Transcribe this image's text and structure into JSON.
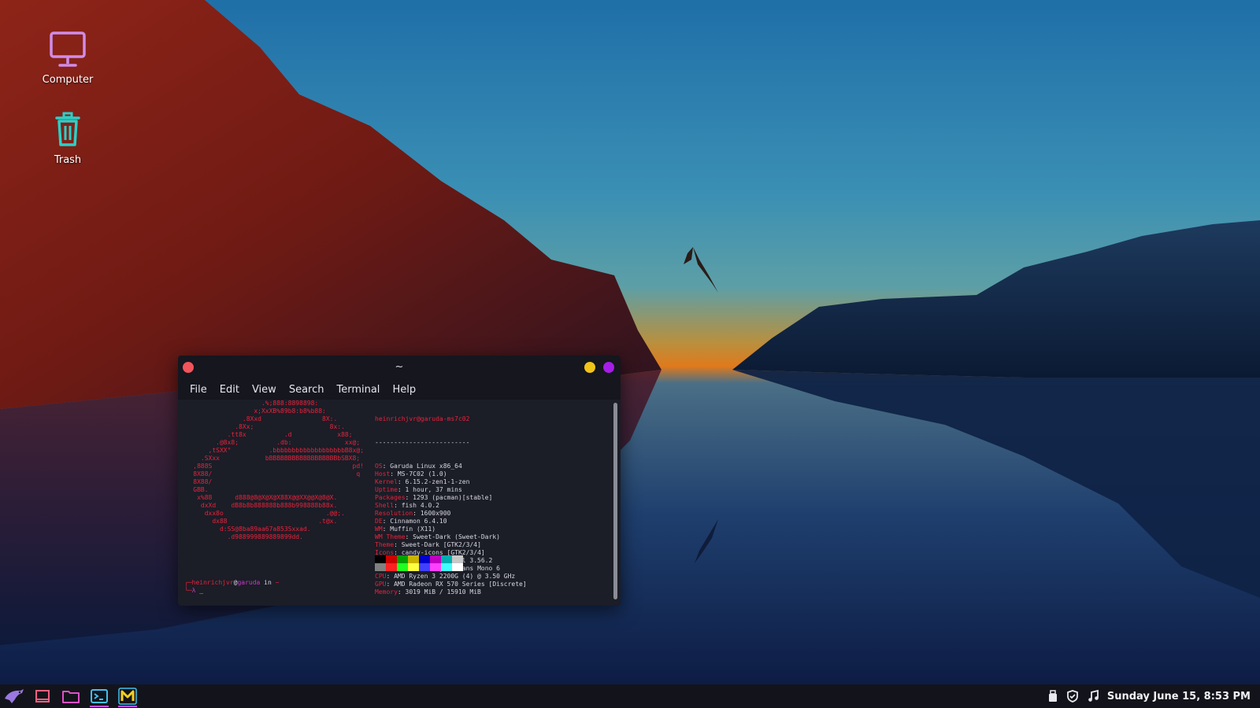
{
  "desktop": {
    "icons": [
      {
        "label": "Computer",
        "icon": "monitor-icon"
      },
      {
        "label": "Trash",
        "icon": "trash-icon"
      }
    ]
  },
  "terminal": {
    "title": "~",
    "menu": [
      "File",
      "Edit",
      "View",
      "Search",
      "Terminal",
      "Help"
    ],
    "logo_lines": [
      "                      .%;888:8898898:",
      "                    x;XxXB%89b8:b8%b88:",
      "                 .8Xxd                8X:.",
      "               .8Xx;                    8x:.",
      "             .tt8x          .d            x88;",
      "          .@8x8;          .db:              xx@;",
      "        ,tSXX°          .bbbbbbbbbbbbbbbbbbbB8x@;",
      "      .SXxx            bBBBBBBBBBBBBBBBBBBbSBX8;",
      "    ,888S                                     pd!",
      "    8X88/                                      q",
      "    8X88/",
      "    GBB.",
      "     x%88      d888@8@X@X@X88X@@XX@@X@8@X.",
      "      dxXd    dB8b8b888888b888b998888b88x.",
      "       dxx8o                           .@@;.",
      "         dx88                        .t@x.",
      "           d:SS@8ba89aa67a853Sxxad.",
      "             .d988999889889899dd."
    ],
    "user_host": "heinrichjvr@garuda-ms7c02",
    "separator": "-------------------------",
    "info": [
      {
        "key": "OS",
        "value": "Garuda Linux x86_64"
      },
      {
        "key": "Host",
        "value": "MS-7C02 (1.0)"
      },
      {
        "key": "Kernel",
        "value": "6.15.2-zen1-1-zen"
      },
      {
        "key": "Uptime",
        "value": "1 hour, 37 mins"
      },
      {
        "key": "Packages",
        "value": "1293 (pacman)[stable]"
      },
      {
        "key": "Shell",
        "value": "fish 4.0.2"
      },
      {
        "key": "Resolution",
        "value": "1600x900"
      },
      {
        "key": "DE",
        "value": "Cinnamon 6.4.10"
      },
      {
        "key": "WM",
        "value": "Muffin (X11)"
      },
      {
        "key": "WM Theme",
        "value": "Sweet-Dark (Sweet-Dark)"
      },
      {
        "key": "Theme",
        "value": "Sweet-Dark [GTK2/3/4]"
      },
      {
        "key": "Icons",
        "value": "candy-icons [GTK2/3/4]"
      },
      {
        "key": "Terminal",
        "value": "GNOME Terminal 3.56.2"
      },
      {
        "key": "Terminal Font",
        "value": "DejaVu Sans Mono 6"
      },
      {
        "key": "CPU",
        "value": "AMD Ryzen 3 2200G (4) @ 3.50 GHz"
      },
      {
        "key": "GPU",
        "value": "AMD Radeon RX 570 Series [Discrete]"
      },
      {
        "key": "Memory",
        "value": "3019 MiB / 15910 MiB"
      }
    ],
    "palette": [
      "#000000",
      "#cc0000",
      "#00a000",
      "#c8b400",
      "#0000cc",
      "#c000c0",
      "#00b0b0",
      "#c8c8c8",
      "#808080",
      "#ff2020",
      "#20ff20",
      "#ffff40",
      "#4040ff",
      "#ff40ff",
      "#40ffff",
      "#ffffff"
    ],
    "prompt": {
      "user": "heinrichjvr",
      "at": "@",
      "host": "garuda",
      "in": " in ",
      "dir": "~",
      "symbol": "λ",
      "cursor": "_"
    }
  },
  "panel": {
    "launchers": [
      {
        "name": "menu-button",
        "icon": "garuda-eagle-icon"
      },
      {
        "name": "show-desktop",
        "icon": "show-desktop-icon"
      },
      {
        "name": "files",
        "icon": "folder-icon"
      },
      {
        "name": "terminal",
        "icon": "terminal-icon"
      },
      {
        "name": "mailspring",
        "icon": "mail-m-icon"
      }
    ],
    "clock": "Sunday June 15, 8:53 PM"
  }
}
